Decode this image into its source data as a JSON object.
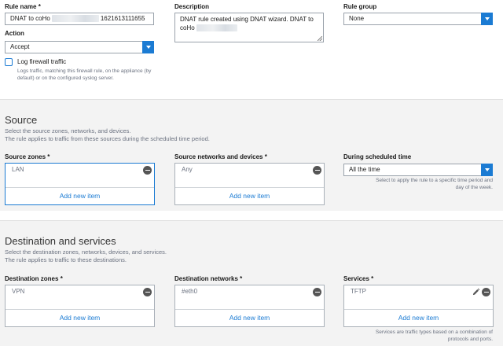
{
  "rule_name": {
    "label": "Rule name",
    "required": "*",
    "value_prefix": "DNAT to coHo",
    "value_suffix": "1621613111655"
  },
  "description": {
    "label": "Description",
    "value_line1": "DNAT rule created using DNAT wizard. DNAT to",
    "value_line2_prefix": "coHo"
  },
  "rule_group": {
    "label": "Rule group",
    "value": "None"
  },
  "action": {
    "label": "Action",
    "value": "Accept"
  },
  "log_firewall": {
    "label": "Log firewall traffic",
    "checked": false,
    "hint_line1": "Logs traffic, matching this firewall rule, on the appliance (by",
    "hint_line2": "default) or on the configured syslog server."
  },
  "source": {
    "title": "Source",
    "subtitle_line1": "Select the source zones, networks, and devices.",
    "subtitle_line2": "The rule applies to traffic from these sources during the scheduled time period.",
    "zones": {
      "label": "Source zones",
      "required": "*",
      "item": "LAN",
      "add": "Add new item"
    },
    "networks": {
      "label": "Source networks and devices",
      "required": "*",
      "item": "Any",
      "add": "Add new item"
    },
    "schedule": {
      "label": "During scheduled time",
      "value": "All the time",
      "hint_line1": "Select to apply the rule to a specific time period and",
      "hint_line2": "day of the week."
    }
  },
  "destination": {
    "title": "Destination and services",
    "subtitle_line1": "Select the destination zones, networks, devices, and services.",
    "subtitle_line2": "The rule applies to traffic to these destinations.",
    "zones": {
      "label": "Destination zones",
      "required": "*",
      "item": "VPN",
      "add": "Add new item"
    },
    "networks": {
      "label": "Destination networks",
      "required": "*",
      "item": "#eth0",
      "add": "Add new item"
    },
    "services": {
      "label": "Services",
      "required": "*",
      "item": "TFTP",
      "add": "Add new item",
      "hint_line1": "Services are traffic types based on a combination of",
      "hint_line2": "protocols and ports."
    }
  },
  "colors": {
    "accent": "#1b7bd3",
    "band": "#f3f3f3"
  }
}
